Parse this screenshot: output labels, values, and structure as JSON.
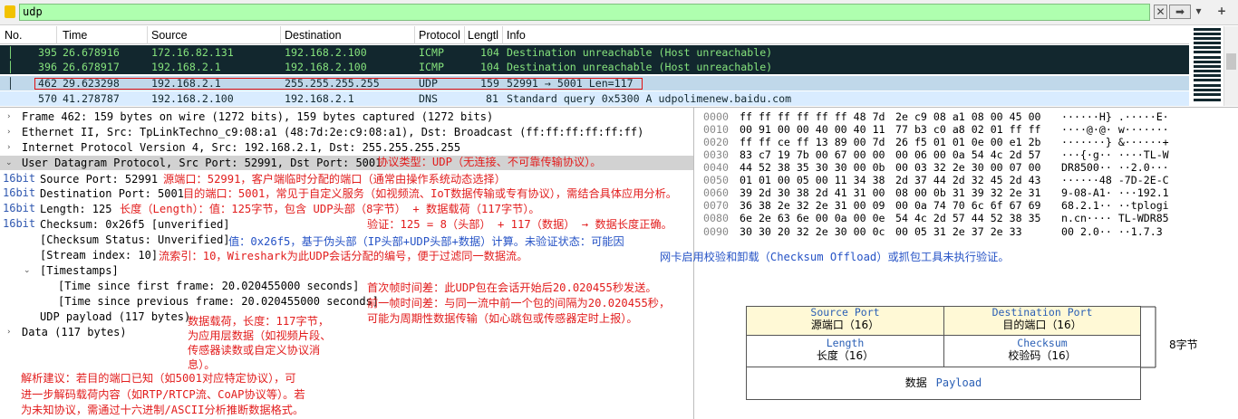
{
  "filter": {
    "value": "udp",
    "clear_label": "✕",
    "apply_label": "➡",
    "dropdown_label": "▾",
    "add_label": "+"
  },
  "packet_list": {
    "columns": [
      "No.",
      "Time",
      "Source",
      "Destination",
      "Protocol",
      "Lengtl",
      "Info"
    ],
    "rows": [
      {
        "no": "395",
        "time": "26.678916",
        "src": "172.16.82.131",
        "dst": "192.168.2.100",
        "proto": "ICMP",
        "len": "104",
        "info": "Destination unreachable (Host unreachable)"
      },
      {
        "no": "396",
        "time": "26.678917",
        "src": "192.168.2.1",
        "dst": "192.168.2.100",
        "proto": "ICMP",
        "len": "104",
        "info": "Destination unreachable (Host unreachable)"
      },
      {
        "no": "462",
        "time": "29.623298",
        "src": "192.168.2.1",
        "dst": "255.255.255.255",
        "proto": "UDP",
        "len": "159",
        "info": "52991 → 5001 Len=117"
      },
      {
        "no": "570",
        "time": "41.278787",
        "src": "192.168.2.100",
        "dst": "192.168.2.1",
        "proto": "DNS",
        "len": "81",
        "info": "Standard query 0x5300 A udpolimenew.baidu.com"
      }
    ]
  },
  "details": {
    "frame": "Frame 462: 159 bytes on wire (1272 bits), 159 bytes captured (1272 bits)",
    "ethernet": "Ethernet II, Src: TpLinkTechno_c9:08:a1 (48:7d:2e:c9:08:a1), Dst: Broadcast (ff:ff:ff:ff:ff:ff)",
    "ip": "Internet Protocol Version 4, Src: 192.168.2.1, Dst: 255.255.255.255",
    "udp": "User Datagram Protocol, Src Port: 52991, Dst Port: 5001",
    "bit_tag": "16bit",
    "src_port": "Source Port: 52991",
    "dst_port": "Destination Port: 5001",
    "length": "Length: 125",
    "checksum": "Checksum: 0x26f5 [unverified]",
    "checksum_status": "[Checksum Status: Unverified]",
    "stream_index": "[Stream index: 10]",
    "timestamps": "[Timestamps]",
    "time_first": "[Time since first frame: 20.020455000 seconds]",
    "time_prev": "[Time since previous frame: 20.020455000 seconds]",
    "payload": "UDP payload (117 bytes)",
    "data": "Data (117 bytes)"
  },
  "notes": {
    "proto_type": "协议类型：UDP（无连接、不可靠传输协议）。",
    "src_port": "源端口：52991，客户端临时分配的端口（通常由操作系统动态选择）",
    "dst_port": "目的端口：5001，常见于自定义服务（如视频流、IoT数据传输或专有协议），需结合具体应用分析。",
    "length": "长度（Length）：值：125字节，包含 UDP头部（8字节） + 数据载荷（117字节）。",
    "verify": "验证：125 = 8（头部） + 117（数据） → 数据长度正确。",
    "checksum": "值：0x26f5，基于伪头部（IP头部+UDP头部+数据）计算。未验证状态：可能因",
    "checksum2": "网卡启用校验和卸载（Checksum Offload）或抓包工具未执行验证。",
    "stream": "流索引：10，Wireshark为此UDP会话分配的编号，便于过滤同一数据流。",
    "time1": "首次帧时间差：此UDP包在会话开始后20.020455秒发送。",
    "time2": "前一帧时间差：与同一流中前一个包的间隔为20.020455秒，",
    "time3": "可能为周期性数据传输（如心跳包或传感器定时上报）。",
    "payload1": "数据载荷，长度：117字节，",
    "payload2": "为应用层数据（如视频片段、",
    "payload3": "传感器读数或自定义协议消",
    "payload4": "息）。",
    "advice1": "解析建议：若目的端口已知（如5001对应特定协议），可",
    "advice2": "进一步解码载荷内容（如RTP/RTCP流、CoAP协议等）。若",
    "advice3": "为未知协议，需通过十六进制/ASCII分析推断数据格式。"
  },
  "hex": [
    {
      "off": "0000",
      "h1": "ff ff ff ff ff ff 48 7d",
      "h2": "2e c9 08 a1 08 00 45 00",
      "asc": "······H} .·····E·"
    },
    {
      "off": "0010",
      "h1": "00 91 00 00 40 00 40 11",
      "h2": "77 b3 c0 a8 02 01 ff ff",
      "asc": "····@·@· w·······"
    },
    {
      "off": "0020",
      "h1": "ff ff ce ff 13 89 00 7d",
      "h2": "26 f5 01 01 0e 00 e1 2b",
      "asc": "·······} &······+"
    },
    {
      "off": "0030",
      "h1": "83 c7 19 7b 00 67 00 00",
      "h2": "00 06 00 0a 54 4c 2d 57",
      "asc": "···{·g·· ····TL-W"
    },
    {
      "off": "0040",
      "h1": "44 52 38 35 30 30 00 0b",
      "h2": "00 03 32 2e 30 00 07 00",
      "asc": "DR8500·· ··2.0···"
    },
    {
      "off": "0050",
      "h1": "01 01 00 05 00 11 34 38",
      "h2": "2d 37 44 2d 32 45 2d 43",
      "asc": "······48 -7D-2E-C"
    },
    {
      "off": "0060",
      "h1": "39 2d 30 38 2d 41 31 00",
      "h2": "08 00 0b 31 39 32 2e 31",
      "asc": "9-08-A1· ···192.1"
    },
    {
      "off": "0070",
      "h1": "36 38 2e 32 2e 31 00 09",
      "h2": "00 0a 74 70 6c 6f 67 69",
      "asc": "68.2.1·· ··tplogi"
    },
    {
      "off": "0080",
      "h1": "6e 2e 63 6e 00 0a 00 0e",
      "h2": "54 4c 2d 57 44 52 38 35",
      "asc": "n.cn···· TL-WDR85"
    },
    {
      "off": "0090",
      "h1": "30 30 20 32 2e 30 00 0c",
      "h2": "00 05 31 2e 37 2e 33",
      "asc": "00 2.0·· ··1.7.3"
    }
  ],
  "diagram": {
    "src_en": "Source Port",
    "src_zh": "源端口（16）",
    "dst_en": "Destination Port",
    "dst_zh": "目的端口（16）",
    "len_en": "Length",
    "len_zh": "长度（16）",
    "chk_en": "Checksum",
    "chk_zh": "校验码（16）",
    "data_zh": "数据",
    "data_en": "Payload",
    "bytes_label": "8字节"
  },
  "colors": {
    "dark_row_bg": "#12272e",
    "dark_row_fg": "#85e27c",
    "selected_row_bg": "#c0d8ea",
    "filter_bg": "#afffaf",
    "note_red": "#e21d1d",
    "note_blue": "#2653c6"
  }
}
